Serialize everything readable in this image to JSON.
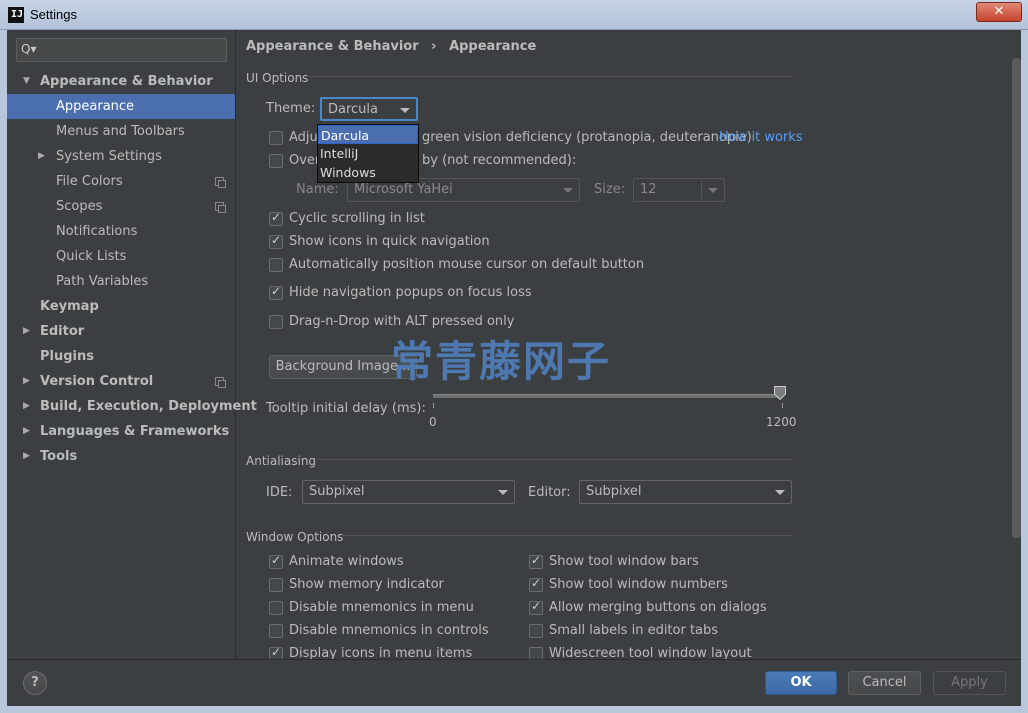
{
  "window": {
    "title": "Settings",
    "app_icon": "IJ",
    "close_icon": "close-icon",
    "close_glyph": "✕"
  },
  "sidebar": {
    "search_placeholder": "",
    "search_icon": "Q▾",
    "items": [
      {
        "label": "Appearance & Behavior",
        "bold": true,
        "expanded": true
      },
      {
        "label": "Appearance",
        "selected": true
      },
      {
        "label": "Menus and Toolbars"
      },
      {
        "label": "System Settings",
        "collapsed": true
      },
      {
        "label": "File Colors"
      },
      {
        "label": "Scopes"
      },
      {
        "label": "Notifications"
      },
      {
        "label": "Quick Lists"
      },
      {
        "label": "Path Variables"
      },
      {
        "label": "Keymap",
        "bold": true
      },
      {
        "label": "Editor",
        "bold": true,
        "collapsed": true
      },
      {
        "label": "Plugins",
        "bold": true
      },
      {
        "label": "Version Control",
        "bold": true,
        "collapsed": true
      },
      {
        "label": "Build, Execution, Deployment",
        "bold": true,
        "collapsed": true
      },
      {
        "label": "Languages & Frameworks",
        "bold": true,
        "collapsed": true
      },
      {
        "label": "Tools",
        "bold": true,
        "collapsed": true
      }
    ]
  },
  "breadcrumb": {
    "parent": "Appearance & Behavior",
    "separator": "›",
    "current": "Appearance"
  },
  "ui_options": {
    "title": "UI Options",
    "theme_label": "Theme:",
    "theme_value": "Darcula",
    "theme_options": [
      "Darcula",
      "IntelliJ",
      "Windows"
    ],
    "adjust_label": "Adjust colors for red-green vision deficiency (protanopia, deuteranopia)",
    "adjust_visible": "Adju",
    "adjust_tail": "green vision deficiency (protanopia, deuteranopia)",
    "how_it_works": "How it works",
    "override_visible": "Over",
    "override_tail": "by (not recommended):",
    "name_label": "Name:",
    "name_value": "Microsoft YaHei",
    "size_label": "Size:",
    "size_value": "12",
    "cyclic": "Cyclic scrolling in list",
    "show_icons_nav": "Show icons in quick navigation",
    "auto_cursor": "Automatically position mouse cursor on default button",
    "hide_nav": "Hide navigation popups on focus loss",
    "drag_drop": "Drag-n-Drop with ALT pressed only",
    "background_image": "Background Image...",
    "tooltip_label": "Tooltip initial delay (ms):",
    "tooltip_min": "0",
    "tooltip_max": "1200",
    "tooltip_value": 1200
  },
  "antialiasing": {
    "title": "Antialiasing",
    "ide_label": "IDE:",
    "ide_value": "Subpixel",
    "editor_label": "Editor:",
    "editor_value": "Subpixel"
  },
  "window_options": {
    "title": "Window Options",
    "animate": "Animate windows",
    "memory": "Show memory indicator",
    "mnem_menu": "Disable mnemonics in menu",
    "mnem_controls": "Disable mnemonics in controls",
    "display_icons": "Display icons in menu items",
    "tool_bars": "Show tool window bars",
    "tool_numbers": "Show tool window numbers",
    "merge_buttons": "Allow merging buttons on dialogs",
    "small_labels": "Small labels in editor tabs",
    "widescreen": "Widescreen tool window layout"
  },
  "watermark": "常青藤网子",
  "footer": {
    "help": "?",
    "ok": "OK",
    "cancel": "Cancel",
    "apply": "Apply"
  },
  "colors": {
    "background": "#3c3f41",
    "selection": "#4b6eaf",
    "link": "#589df6",
    "primary_button": "#4a7bb8"
  }
}
